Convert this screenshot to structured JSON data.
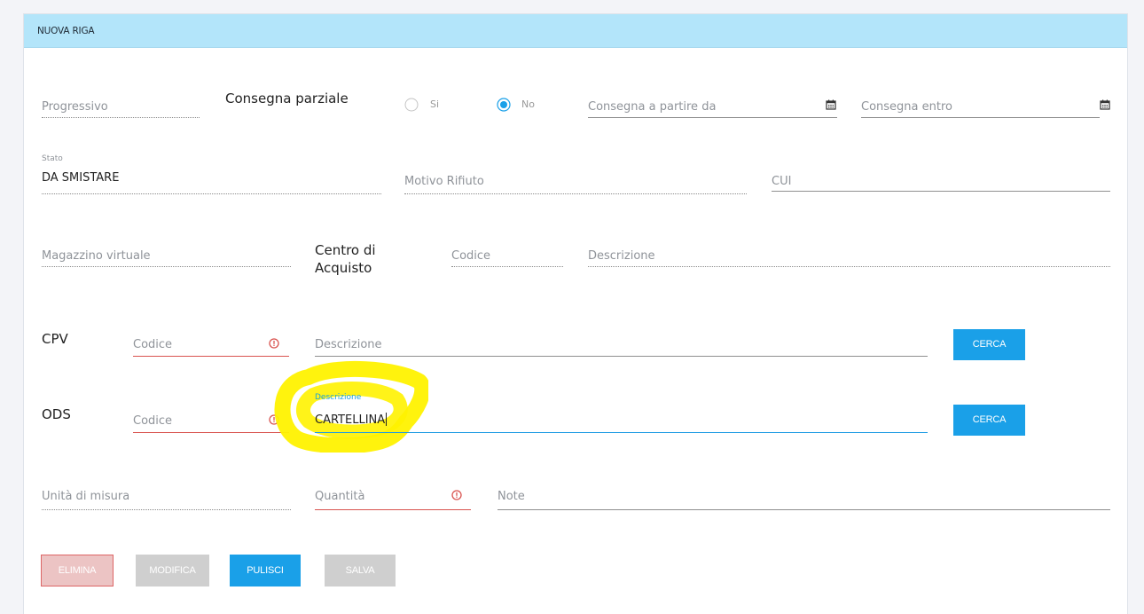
{
  "panel": {
    "title": "NUOVA RIGA"
  },
  "row1": {
    "progressivo_placeholder": "Progressivo",
    "consegna_parziale_label": "Consegna parziale",
    "radio_si_label": "Si",
    "radio_no_label": "No",
    "radio_selected": "No",
    "consegna_da_placeholder": "Consegna a partire da",
    "consegna_entro_placeholder": "Consegna entro"
  },
  "row2": {
    "stato_label": "Stato",
    "stato_value": "DA SMISTARE",
    "motivo_rifiuto_placeholder": "Motivo Rifiuto",
    "cui_placeholder": "CUI"
  },
  "row3": {
    "magazzino_placeholder": "Magazzino virtuale",
    "centro_label_line1": "Centro di",
    "centro_label_line2": "Acquisto",
    "codice_placeholder": "Codice",
    "descrizione_placeholder": "Descrizione"
  },
  "cpv": {
    "label": "CPV",
    "codice_placeholder": "Codice",
    "descrizione_placeholder": "Descrizione",
    "cerca_label": "CERCA"
  },
  "ods": {
    "label": "ODS",
    "codice_placeholder": "Codice",
    "descrizione_label": "Descrizione",
    "descrizione_value": "CARTELLINA",
    "cerca_label": "CERCA"
  },
  "row6": {
    "unita_placeholder": "Unità di misura",
    "quantita_placeholder": "Quantità",
    "note_placeholder": "Note"
  },
  "actions": {
    "elimina_label": "ELIMINA",
    "modifica_label": "MODIFICA",
    "pulisci_label": "PULISCI",
    "salva_label": "SALVA"
  },
  "colors": {
    "header_bg": "#b3e5fa",
    "primary": "#1aa0e8",
    "error": "#d9534f",
    "disabled": "#cccccc",
    "highlight": "#fff200"
  },
  "icons": {
    "calendar": "calendar-icon",
    "error": "error-icon",
    "radio": "radio-button"
  }
}
